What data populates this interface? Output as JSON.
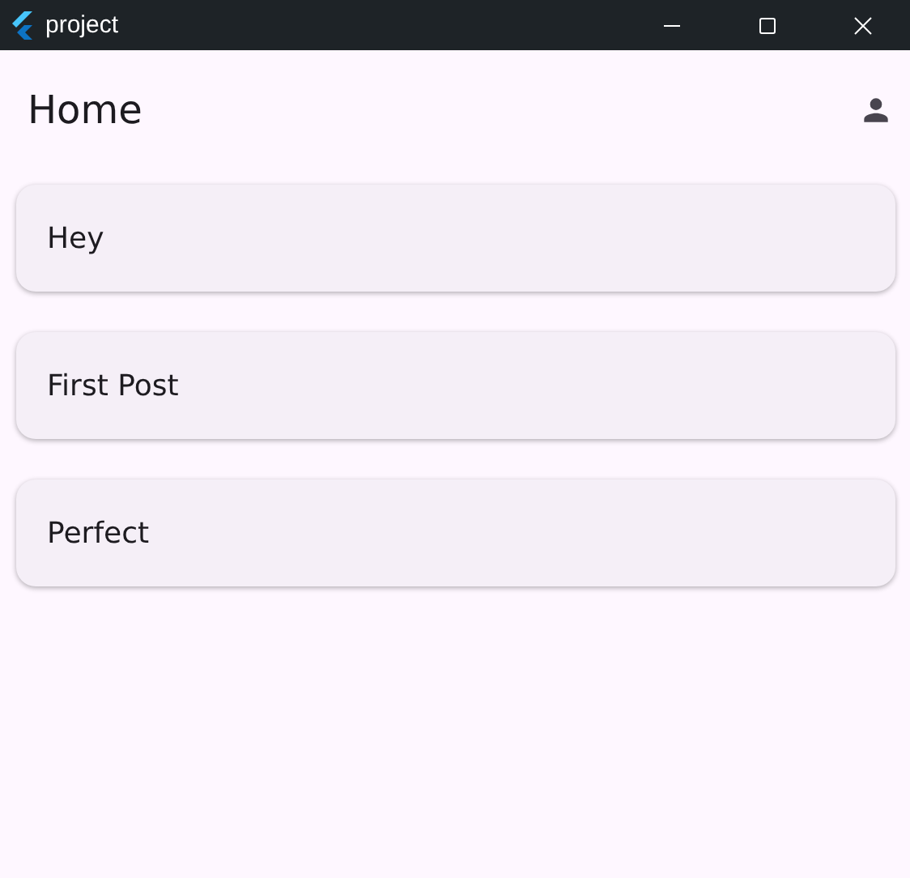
{
  "window": {
    "title": "project"
  },
  "app_bar": {
    "title": "Home"
  },
  "posts": [
    {
      "text": "Hey"
    },
    {
      "text": "First Post"
    },
    {
      "text": "Perfect"
    }
  ]
}
